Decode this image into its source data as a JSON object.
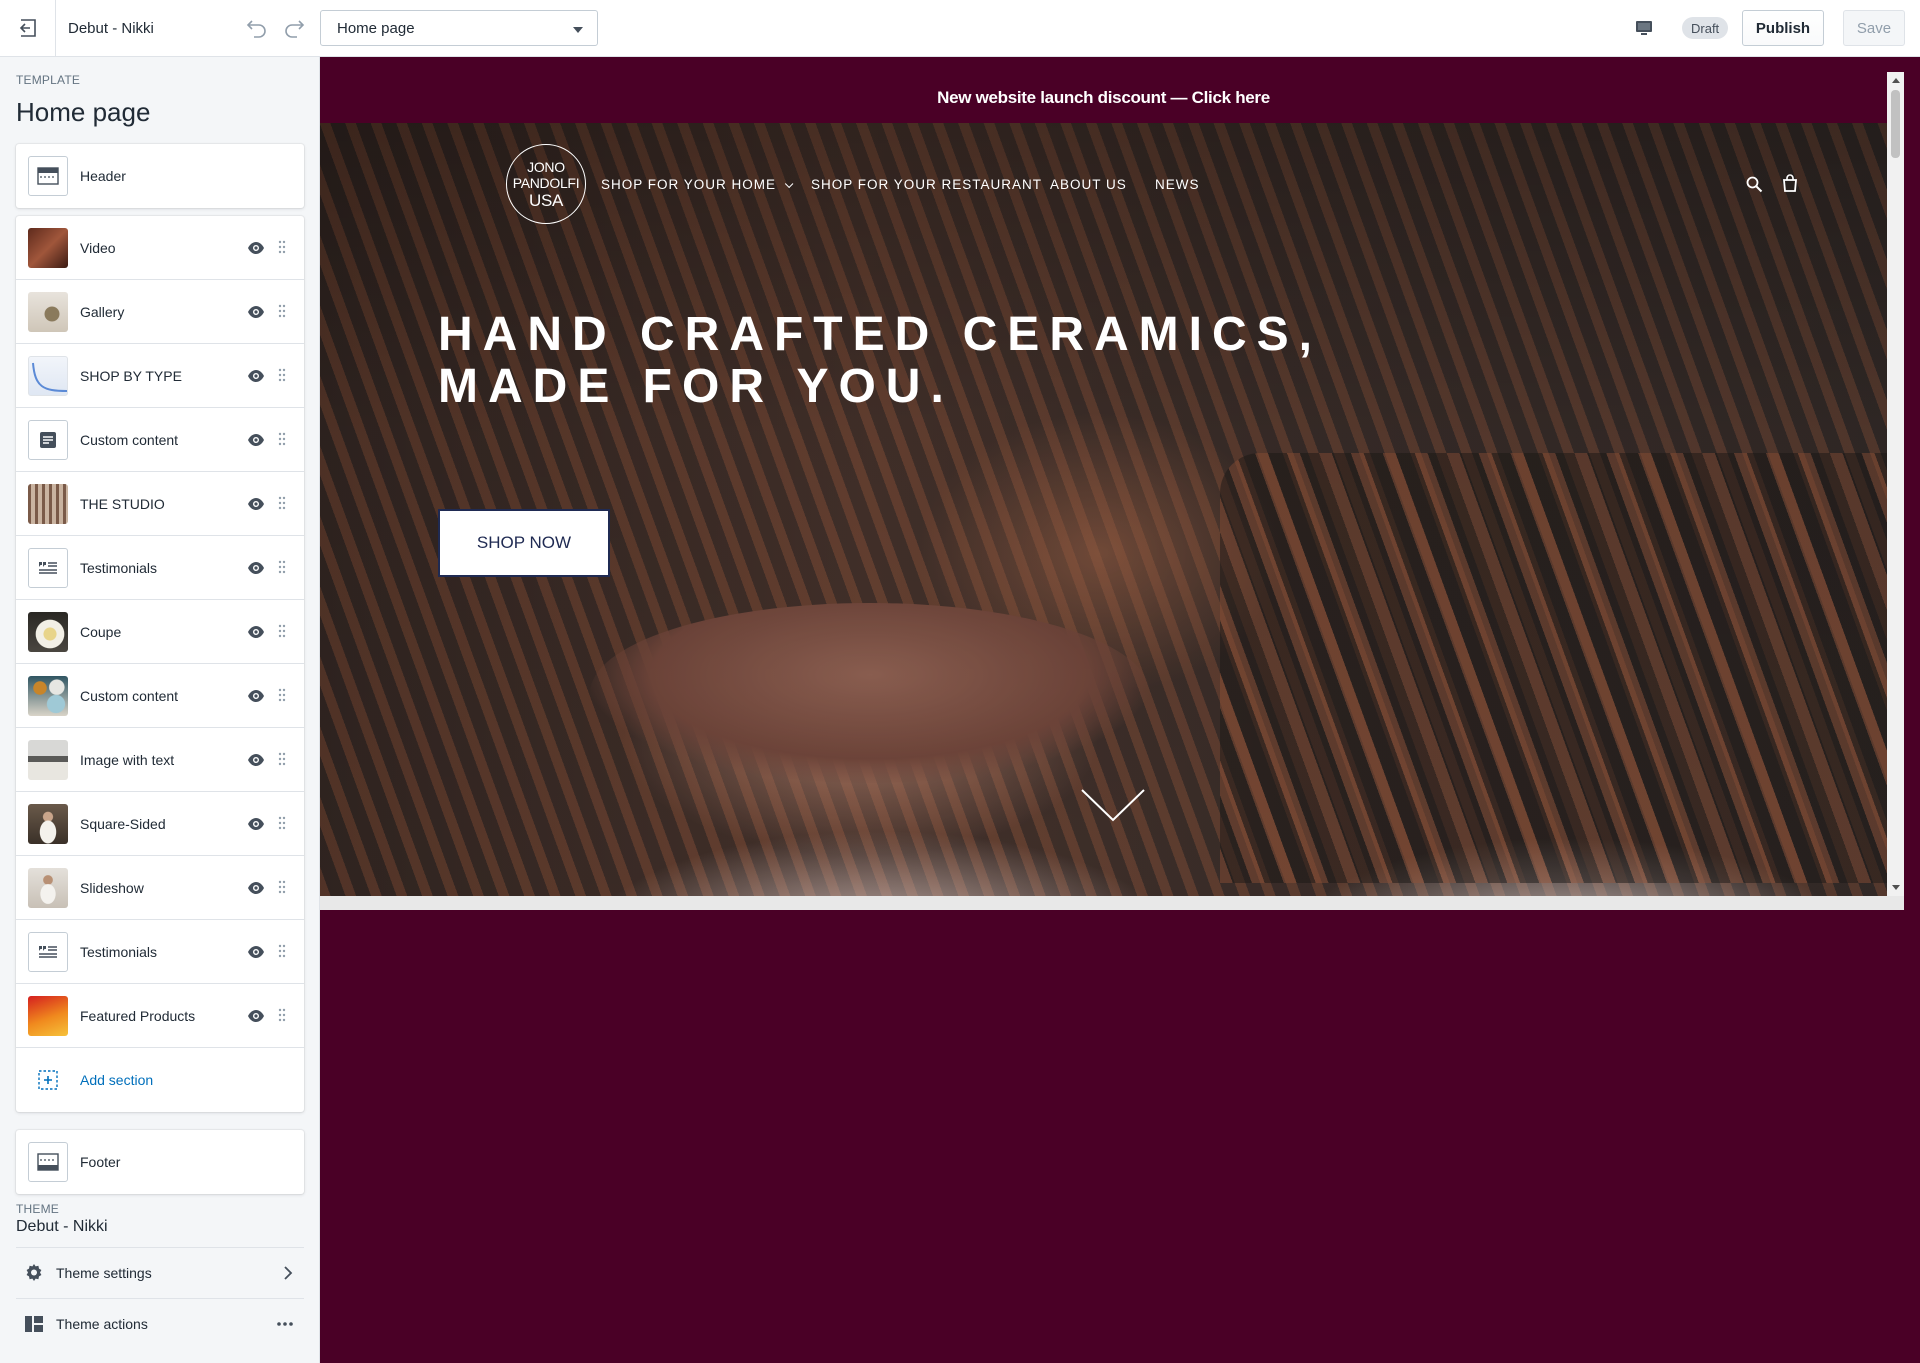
{
  "topbar": {
    "theme_name": "Debut - Nikki",
    "page_select": "Home page",
    "draft_badge": "Draft",
    "publish_label": "Publish",
    "save_label": "Save"
  },
  "sidebar": {
    "template_eyebrow": "TEMPLATE",
    "template_title": "Home page",
    "header_label": "Header",
    "sections": [
      {
        "label": "Video",
        "thumb": "video"
      },
      {
        "label": "Gallery",
        "thumb": "gallery"
      },
      {
        "label": "SHOP BY TYPE",
        "thumb": "shop-by-type"
      },
      {
        "label": "Custom content",
        "thumb": "text-icon"
      },
      {
        "label": "THE STUDIO",
        "thumb": "studio"
      },
      {
        "label": "Testimonials",
        "thumb": "quote-icon"
      },
      {
        "label": "Coupe",
        "thumb": "coupe"
      },
      {
        "label": "Custom content",
        "thumb": "dishes"
      },
      {
        "label": "Image with text",
        "thumb": "kitchen"
      },
      {
        "label": "Square-Sided",
        "thumb": "chef"
      },
      {
        "label": "Slideshow",
        "thumb": "slideshow"
      },
      {
        "label": "Testimonials",
        "thumb": "quote-icon"
      },
      {
        "label": "Featured Products",
        "thumb": "featured"
      }
    ],
    "add_section_label": "Add section",
    "footer_label": "Footer",
    "theme_eyebrow": "THEME",
    "theme_title": "Debut - Nikki",
    "theme_settings_label": "Theme settings",
    "theme_actions_label": "Theme actions"
  },
  "preview": {
    "announcement": "New website launch discount — Click here",
    "logo_lines": [
      "JONO",
      "PANDOLFI",
      "USA"
    ],
    "nav": [
      "SHOP FOR YOUR HOME",
      "SHOP FOR YOUR RESTAURANT",
      "ABOUT US",
      "NEWS"
    ],
    "hero_title_line1": "HAND CRAFTED CERAMICS,",
    "hero_title_line2": "MADE FOR YOU.",
    "shop_now": "SHOP NOW"
  },
  "colors": {
    "brand_maroon": "#4a0026",
    "link_blue": "#006fbb",
    "button_navy": "#1f2a52"
  }
}
